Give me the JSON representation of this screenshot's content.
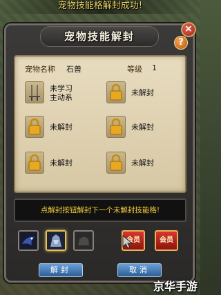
{
  "toast": "宠物技能格解封成功!",
  "window": {
    "title": "宠物技能解封",
    "close_icon": "×",
    "help_icon": "?"
  },
  "info": {
    "name_label": "宠物名称",
    "name_value": "石兽",
    "level_label": "等级",
    "level_value": "1"
  },
  "skills": [
    {
      "icon": "sword-icon",
      "line1": "未学习",
      "line2": "主动系"
    },
    {
      "icon": "lock-icon",
      "line1": "未解封",
      "line2": ""
    },
    {
      "icon": "lock-icon",
      "line1": "未解封",
      "line2": ""
    },
    {
      "icon": "lock-icon",
      "line1": "未解封",
      "line2": ""
    },
    {
      "icon": "lock-icon",
      "line1": "未解封",
      "line2": ""
    },
    {
      "icon": "lock-icon",
      "line1": "未解封",
      "line2": ""
    }
  ],
  "message": "点解封按钮解封下一个未解封技能格!",
  "pets": {
    "vip1": "会员",
    "vip2": "会员"
  },
  "buttons": {
    "unseal": "解封",
    "cancel": "取消"
  },
  "watermark": "京华手游"
}
